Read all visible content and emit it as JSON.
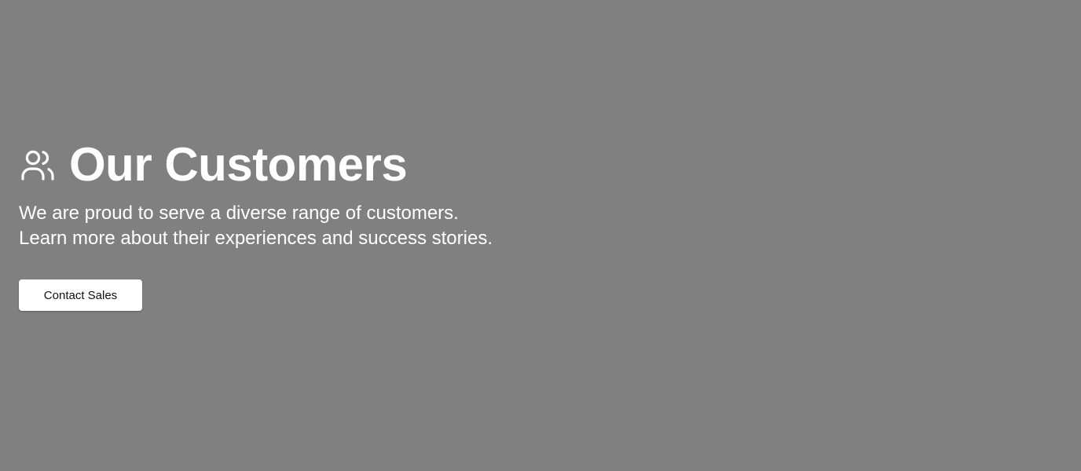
{
  "hero": {
    "icon": "users-icon",
    "title": "Our Customers",
    "description": "We are proud to serve a diverse range of customers. Learn more about their experiences and success stories.",
    "cta_label": "Contact Sales"
  },
  "colors": {
    "background": "#808080",
    "text": "#ffffff",
    "button_background": "#ffffff",
    "button_text": "#111111"
  }
}
